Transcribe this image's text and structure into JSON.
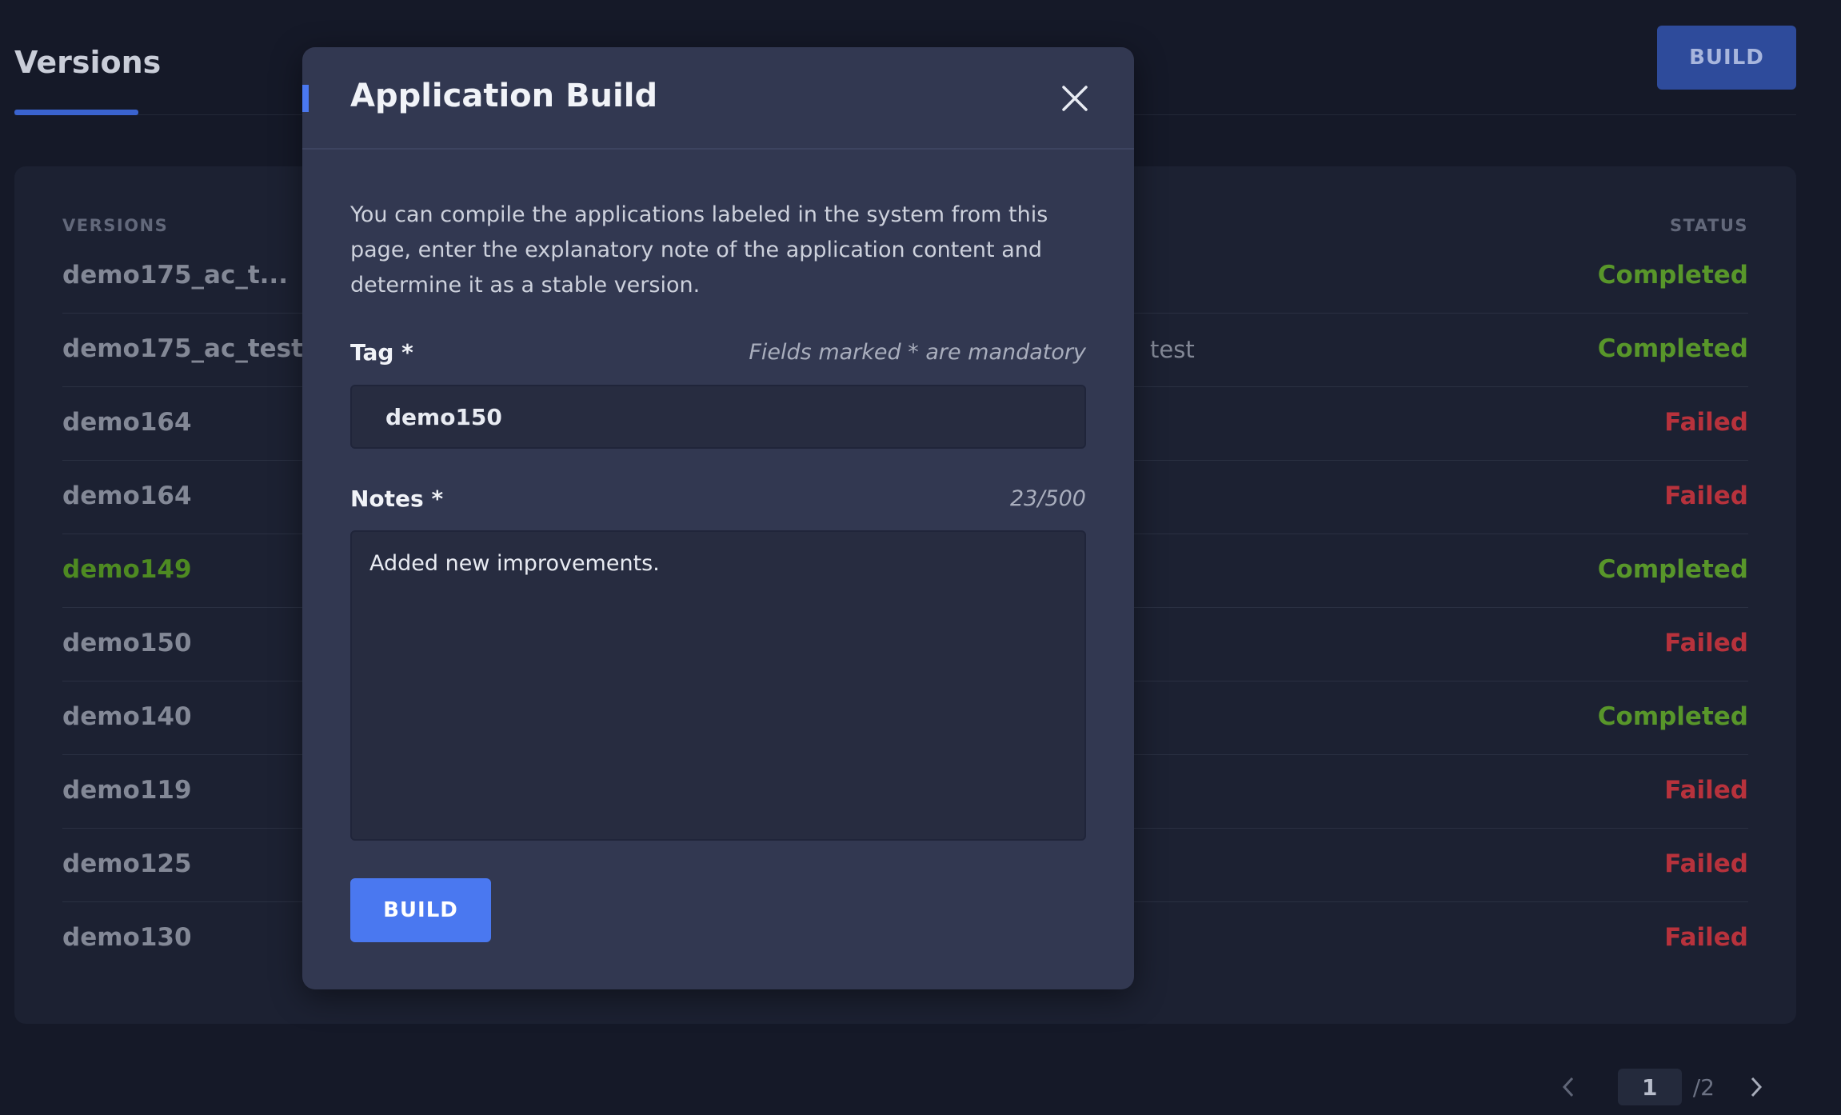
{
  "page": {
    "title": "Versions",
    "build_label": "BUILD"
  },
  "table": {
    "columns": {
      "versions": "VERSIONS",
      "status": "STATUS"
    },
    "rows": [
      {
        "version": "demo175_ac_t...",
        "middle": "",
        "status": "Completed",
        "state": "completed"
      },
      {
        "version": "demo175_ac_test",
        "middle": "test",
        "status": "Completed",
        "state": "completed"
      },
      {
        "version": "demo164",
        "middle": "",
        "status": "Failed",
        "state": "failed"
      },
      {
        "version": "demo164",
        "middle": "",
        "status": "Failed",
        "state": "failed"
      },
      {
        "version": "demo149",
        "middle": "",
        "status": "Completed",
        "state": "completed",
        "active": true
      },
      {
        "version": "demo150",
        "middle": "",
        "status": "Failed",
        "state": "failed"
      },
      {
        "version": "demo140",
        "middle": "",
        "status": "Completed",
        "state": "completed"
      },
      {
        "version": "demo119",
        "middle": "",
        "status": "Failed",
        "state": "failed"
      },
      {
        "version": "demo125",
        "middle": "",
        "status": "Failed",
        "state": "failed"
      },
      {
        "version": "demo130",
        "middle": "",
        "status": "Failed",
        "state": "failed"
      }
    ]
  },
  "pagination": {
    "current": "1",
    "total": "/2"
  },
  "modal": {
    "title": "Application Build",
    "description": "You can compile the applications labeled in the system from this page, enter the explanatory note of the application content and determine it as a stable version.",
    "tag_label": "Tag *",
    "mandatory_hint": "Fields marked * are mandatory",
    "tag_value": "demo150",
    "notes_label": "Notes *",
    "notes_count": "23/500",
    "notes_value": "Added new improvements.",
    "build_label": "BUILD"
  },
  "colors": {
    "background": "#151928",
    "card": "#1c2132",
    "modal": "#323851",
    "accent": "#4a78f0",
    "completed": "#58962a",
    "failed": "#b7323c",
    "active_version": "#4e8a22"
  },
  "icons": {
    "close": "close-icon",
    "prev": "chevron-left-icon",
    "next": "chevron-right-icon"
  }
}
